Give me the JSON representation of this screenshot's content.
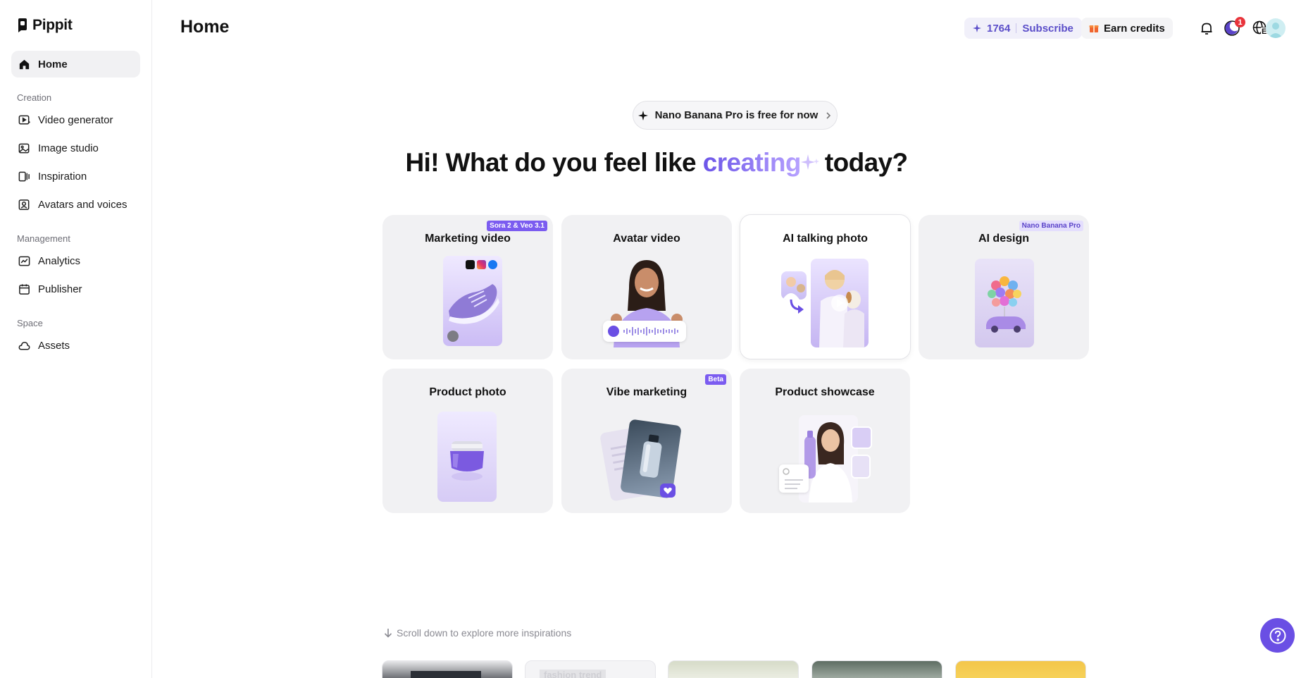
{
  "app": {
    "name": "Pippit"
  },
  "sidebar": {
    "home": "Home",
    "sections": [
      {
        "label": "Creation",
        "items": [
          "Video generator",
          "Image studio",
          "Inspiration",
          "Avatars and voices"
        ]
      },
      {
        "label": "Management",
        "items": [
          "Analytics",
          "Publisher"
        ]
      },
      {
        "label": "Space",
        "items": [
          "Assets"
        ]
      }
    ]
  },
  "header": {
    "title": "Home",
    "credits": "1764",
    "subscribe": "Subscribe",
    "earn_credits": "Earn credits",
    "notification_count": "1",
    "language": "EN"
  },
  "promo": {
    "text": "Nano Banana Pro is free for now"
  },
  "hero": {
    "before": "Hi! What do you feel like ",
    "accent": "creating",
    "after": "today?"
  },
  "cards": [
    {
      "title": "Marketing video",
      "tag": "Sora 2 & Veo 3.1"
    },
    {
      "title": "Avatar video"
    },
    {
      "title": "AI talking photo"
    },
    {
      "title": "AI design",
      "tag": "Nano Banana Pro"
    },
    {
      "title": "Product photo"
    },
    {
      "title": "Vibe marketing",
      "tag": "Beta"
    },
    {
      "title": "Product showcase"
    }
  ],
  "footer": {
    "scroll_hint": "Scroll down to explore more inspirations",
    "inspiration_partial_text": "fashion trend"
  },
  "colors": {
    "accent": "#6a4fe4",
    "badge": "#e8343b"
  }
}
